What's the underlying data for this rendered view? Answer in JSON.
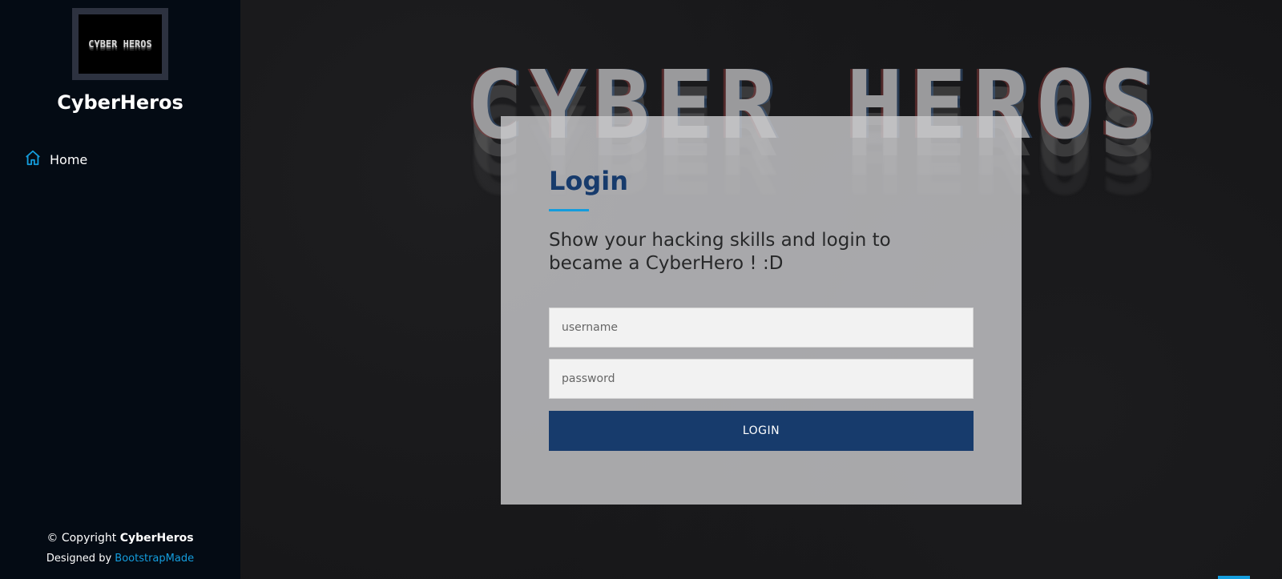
{
  "sidebar": {
    "logo_text": "CYBER HEROS",
    "brand": "CyberHeros",
    "nav": [
      {
        "label": "Home",
        "icon": "home-icon"
      }
    ],
    "footer": {
      "copyright_prefix": "© Copyright ",
      "copyright_name": "CyberHeros",
      "designed_prefix": "Designed by ",
      "designed_link": "BootstrapMade"
    }
  },
  "hero": {
    "title": "CYBER HEROS"
  },
  "login": {
    "title": "Login",
    "subtitle": "Show your hacking skills and login to became a CyberHero ! :D",
    "username_placeholder": "username",
    "password_placeholder": "password",
    "button_label": "LOGIN"
  },
  "colors": {
    "sidebar_bg": "#040b14",
    "accent": "#149ddd",
    "primary": "#173b6c"
  }
}
